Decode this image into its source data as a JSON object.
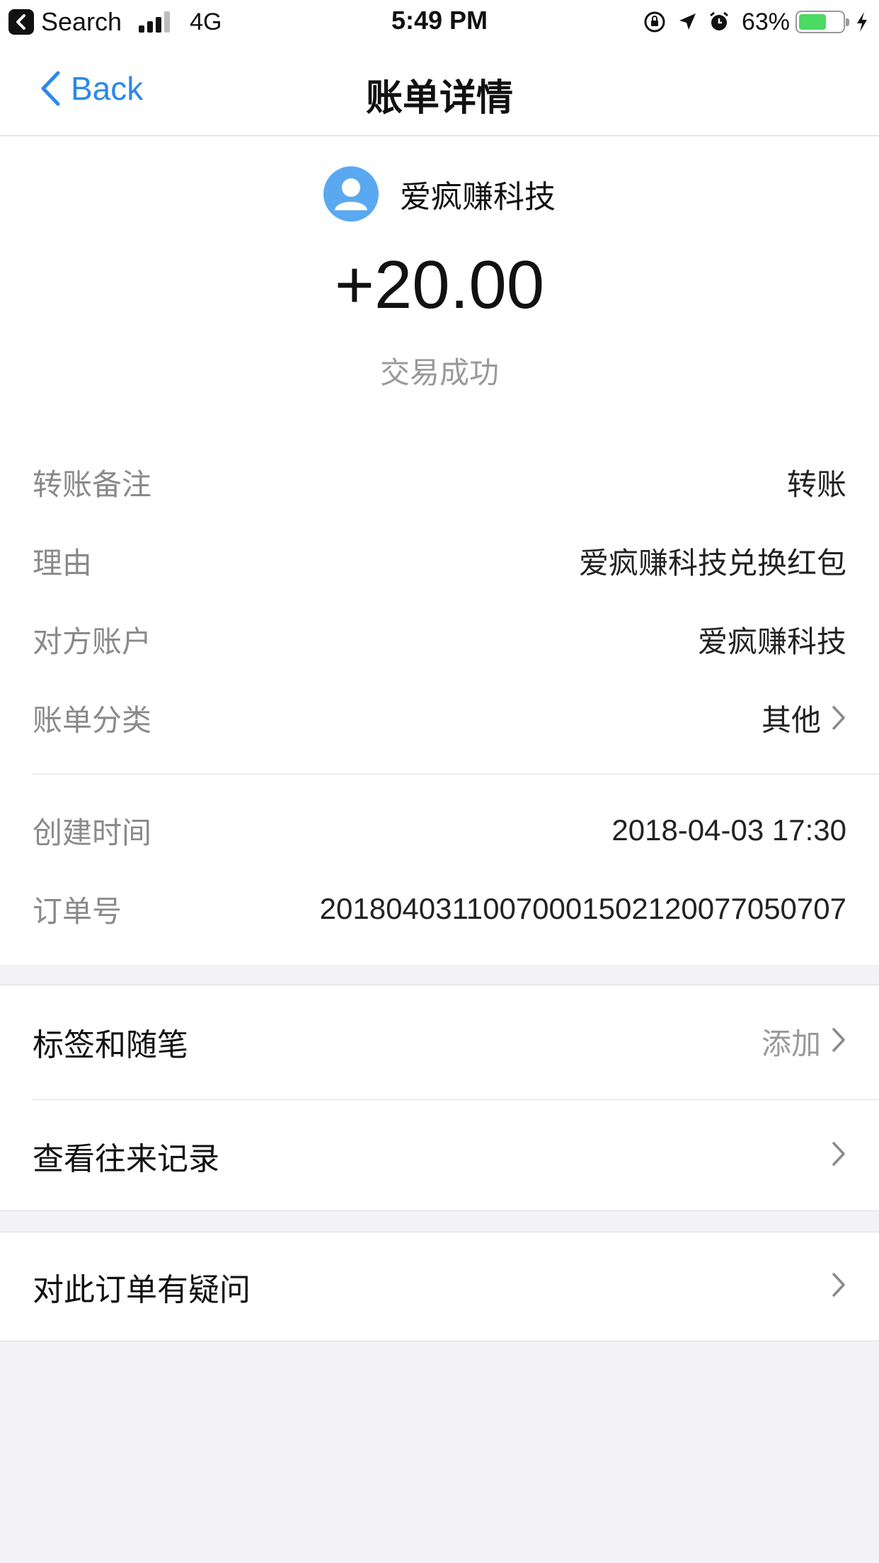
{
  "status_bar": {
    "back_app": "Search",
    "network": "4G",
    "time": "5:49 PM",
    "battery_pct": "63%",
    "battery_level": 0.63
  },
  "nav": {
    "back_label": "Back",
    "title": "账单详情"
  },
  "summary": {
    "merchant_name": "爱疯赚科技",
    "amount": "+20.00",
    "status": "交易成功"
  },
  "details": [
    {
      "label": "转账备注",
      "value": "转账"
    },
    {
      "label": "理由",
      "value": "爱疯赚科技兑换红包"
    },
    {
      "label": "对方账户",
      "value": "爱疯赚科技"
    },
    {
      "label": "账单分类",
      "value": "其他"
    },
    {
      "label": "创建时间",
      "value": "2018-04-03 17:30"
    },
    {
      "label": "订单号",
      "value": "20180403110070001502120077050707"
    }
  ],
  "actions": {
    "tags_label": "标签和随笔",
    "tags_hint": "添加",
    "history_label": "查看往来记录",
    "question_label": "对此订单有疑问"
  },
  "colors": {
    "accent": "#2d88e8",
    "avatar": "#5aa9f0",
    "battery": "#4cd964",
    "background": "#f3f3f7"
  }
}
